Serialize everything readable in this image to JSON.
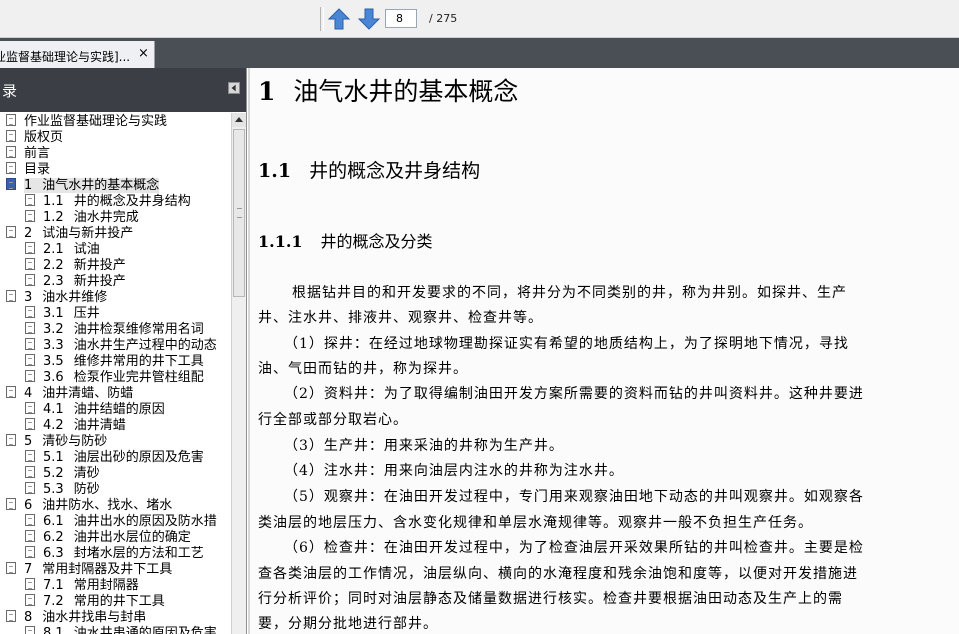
{
  "toolbar": {
    "current_page": "8",
    "total_pages": "/ 275"
  },
  "tab": {
    "title": "业监督基础理论与实践]...",
    "close": "×"
  },
  "sidebar": {
    "title": "录",
    "items": [
      {
        "num": "",
        "label": "作业监督基础理论与实践"
      },
      {
        "num": "",
        "label": "版权页"
      },
      {
        "num": "",
        "label": "前言"
      },
      {
        "num": "",
        "label": "目录"
      },
      {
        "num": "1",
        "label": "油气水井的基本概念"
      },
      {
        "num": "1.1",
        "label": "井的概念及井身结构"
      },
      {
        "num": "1.2",
        "label": "油水井完成"
      },
      {
        "num": "2",
        "label": "试油与新井投产"
      },
      {
        "num": "2.1",
        "label": "试油"
      },
      {
        "num": "2.2",
        "label": "新井投产"
      },
      {
        "num": "2.3",
        "label": "新井投产"
      },
      {
        "num": "3",
        "label": "油水井维修"
      },
      {
        "num": "3.1",
        "label": "压井"
      },
      {
        "num": "3.2",
        "label": "油井检泵维修常用名词"
      },
      {
        "num": "3.3",
        "label": "油水井生产过程中的动态"
      },
      {
        "num": "3.5",
        "label": "维修井常用的井下工具"
      },
      {
        "num": "3.6",
        "label": "检泵作业完井管柱组配"
      },
      {
        "num": "4",
        "label": "油井清蜡、防蜡"
      },
      {
        "num": "4.1",
        "label": "油井结蜡的原因"
      },
      {
        "num": "4.2",
        "label": "油井清蜡"
      },
      {
        "num": "5",
        "label": "清砂与防砂"
      },
      {
        "num": "5.1",
        "label": "油层出砂的原因及危害"
      },
      {
        "num": "5.2",
        "label": "清砂"
      },
      {
        "num": "5.3",
        "label": "防砂"
      },
      {
        "num": "6",
        "label": "油井防水、找水、堵水"
      },
      {
        "num": "6.1",
        "label": "油井出水的原因及防水措"
      },
      {
        "num": "6.2",
        "label": "油井出水层位的确定"
      },
      {
        "num": "6.3",
        "label": "封堵水层的方法和工艺"
      },
      {
        "num": "7",
        "label": "常用封隔器及井下工具"
      },
      {
        "num": "7.1",
        "label": "常用封隔器"
      },
      {
        "num": "7.2",
        "label": "常用的井下工具"
      },
      {
        "num": "8",
        "label": "油水井找串与封串"
      },
      {
        "num": "8.1",
        "label": "油水井串通的原因及危害"
      }
    ]
  },
  "content": {
    "h1_num": "1",
    "h1_text": "油气水井的基本概念",
    "h2_num": "1.1",
    "h2_text": "井的概念及井身结构",
    "h3_num": "1.1.1",
    "h3_text": "井的概念及分类",
    "lines": [
      "根据钻井目的和开发要求的不同，将井分为不同类别的井，称为井别。如探井、生产",
      "井、注水井、排液井、观察井、检查井等。",
      "（1）探井：在经过地球物理勘探证实有希望的地质结构上，为了探明地下情况，寻找",
      "油、气田而钻的井，称为探井。",
      "（2）资料井：为了取得编制油田开发方案所需要的资料而钻的井叫资料井。这种井要进",
      "行全部或部分取岩心。",
      "（3）生产井：用来采油的井称为生产井。",
      "（4）注水井：用来向油层内注水的井称为注水井。",
      "（5）观察井：在油田开发过程中，专门用来观察油田地下动态的井叫观察井。如观察各",
      "类油层的地层压力、含水变化规律和单层水淹规律等。观察井一般不负担生产任务。",
      "（6）检查井：在油田开发过程中，为了检查油层开采效果所钻的井叫检查井。主要是检",
      "查各类油层的工作情况，油层纵向、横向的水淹程度和残余油饱和度等，以便对开发措施进",
      "行分析评价；同时对油层静态及储量数据进行核实。检查井要根据油田动态及生产上的需",
      "要，分期分批地进行部井。"
    ]
  }
}
